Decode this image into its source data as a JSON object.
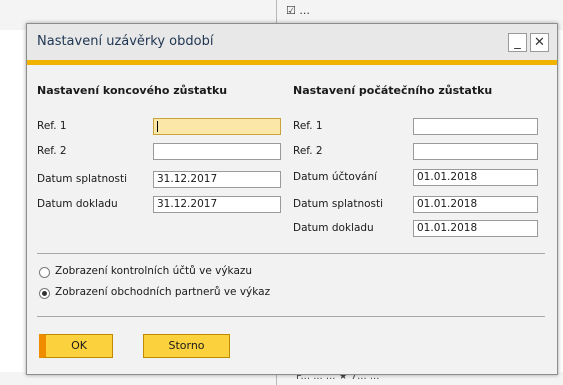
{
  "background": {
    "top_text": "☑ ...",
    "bottom_text": "P... ... ...  ★  7... ..."
  },
  "dialog": {
    "title": "Nastavení uzávěrky období",
    "minimize_label": "_",
    "close_label": "✕",
    "accent_color": "#f0b400",
    "closing": {
      "heading": "Nastavení koncového zůstatku",
      "ref1_label": "Ref. 1",
      "ref1_value": "",
      "ref2_label": "Ref. 2",
      "ref2_value": "",
      "due_date_label": "Datum splatnosti",
      "due_date_value": "31.12.2017",
      "doc_date_label": "Datum dokladu",
      "doc_date_value": "31.12.2017"
    },
    "opening": {
      "heading": "Nastavení počátečního zůstatku",
      "ref1_label": "Ref. 1",
      "ref1_value": "",
      "ref2_label": "Ref. 2",
      "ref2_value": "",
      "posting_date_label": "Datum účtování",
      "posting_date_value": "01.01.2018",
      "due_date_label": "Datum splatnosti",
      "due_date_value": "01.01.2018",
      "doc_date_label": "Datum dokladu",
      "doc_date_value": "01.01.2018"
    },
    "options": [
      {
        "label": "Zobrazení kontrolních účtů ve výkazu",
        "selected": false
      },
      {
        "label": "Zobrazení obchodních partnerů ve výkaz",
        "selected": true
      }
    ],
    "buttons": {
      "ok_label": "OK",
      "cancel_label": "Storno"
    }
  }
}
